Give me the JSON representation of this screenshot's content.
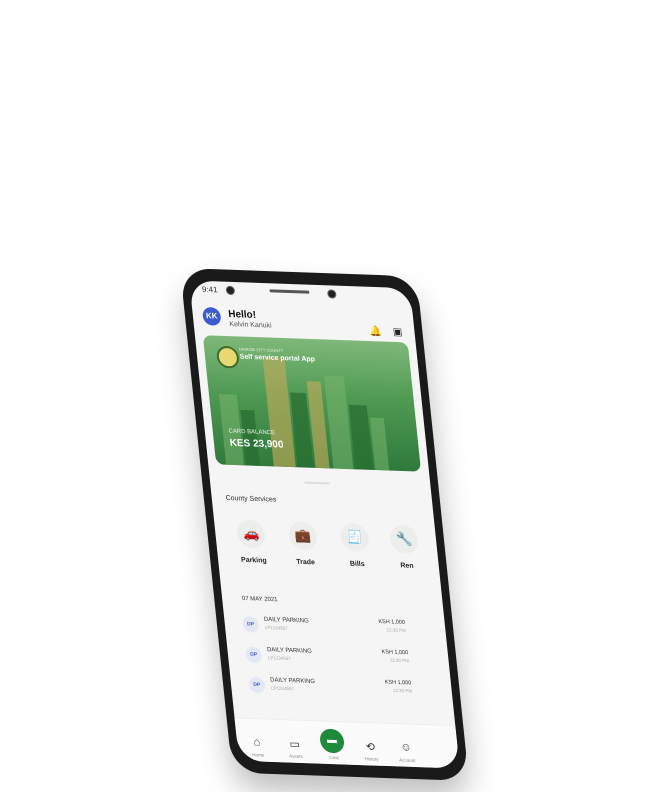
{
  "status_bar": {
    "time": "9:41"
  },
  "header": {
    "avatar_initials": "KK",
    "greeting": "Hello!",
    "user_name": "Kelvin Kariuki",
    "icons": [
      "bell-icon",
      "qr-scan-icon"
    ]
  },
  "card": {
    "org": "NAIROBI CITY COUNTY",
    "title": "Self service portal App",
    "balance_label": "CARD BALANCE",
    "balance_value": "KES 23,900",
    "colors": {
      "top": "#7fb87a",
      "bottom": "#2f7a3c"
    }
  },
  "services": {
    "title": "County Services",
    "items": [
      {
        "label": "Parking",
        "icon": "car-icon"
      },
      {
        "label": "Trade",
        "icon": "briefcase-icon"
      },
      {
        "label": "Bills",
        "icon": "receipt-icon"
      },
      {
        "label": "Ren",
        "icon": "wrench-icon"
      }
    ]
  },
  "transactions": {
    "date": "07 MAY 2021",
    "items": [
      {
        "badge": "DP",
        "name": "DAILY PARKING",
        "ref": "LP1234567",
        "amount": "KSH 1,000",
        "time": "12:30 PM"
      },
      {
        "badge": "DP",
        "name": "DAILY PARKING",
        "ref": "LP1234567",
        "amount": "KSH 1,000",
        "time": "12:30 PM"
      },
      {
        "badge": "DP",
        "name": "DAILY PARKING",
        "ref": "LP1234567",
        "amount": "KSH 1,000",
        "time": "12:30 PM"
      }
    ]
  },
  "bottom_nav": {
    "items": [
      {
        "label": "Home",
        "icon": "home-icon"
      },
      {
        "label": "Assets",
        "icon": "folder-icon"
      },
      {
        "label": "Card",
        "icon": "card-icon"
      },
      {
        "label": "History",
        "icon": "history-icon"
      },
      {
        "label": "Account",
        "icon": "user-icon"
      }
    ],
    "accent": "#1f8a3c"
  }
}
